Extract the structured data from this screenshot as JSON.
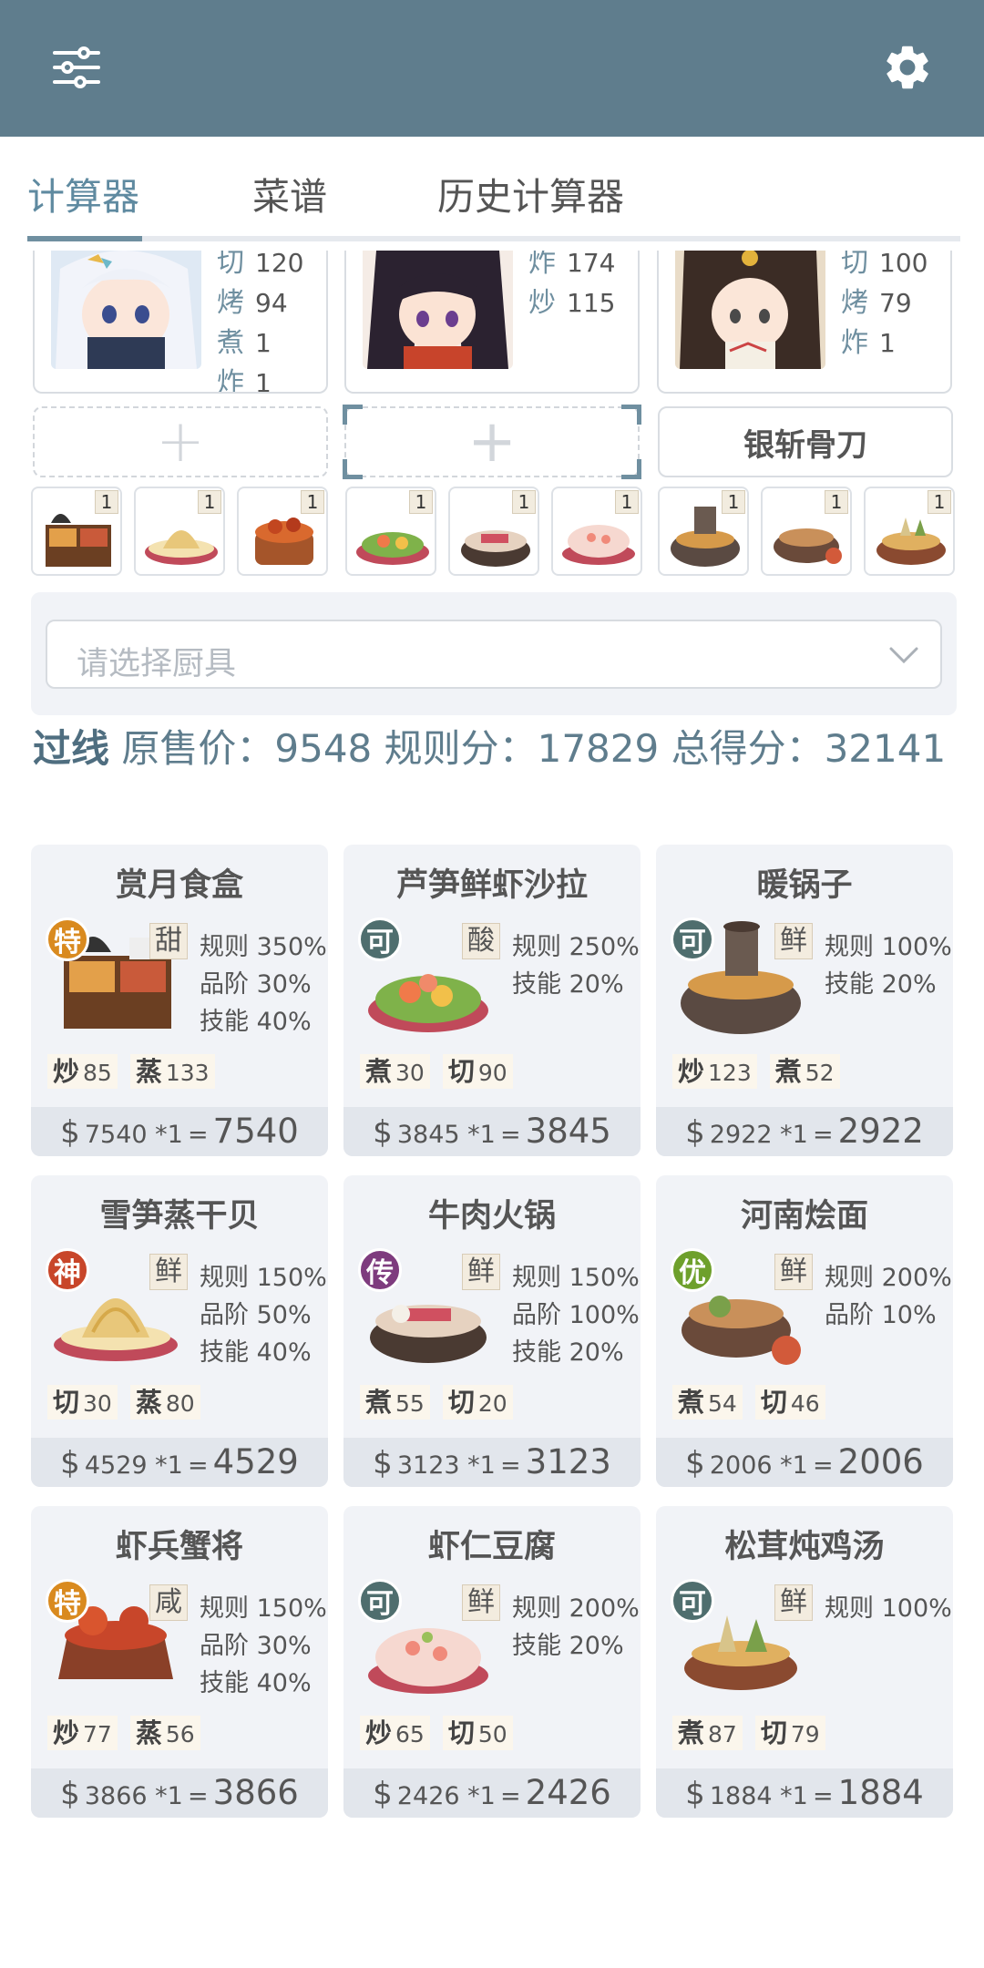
{
  "tabs": [
    {
      "label": "计算器",
      "active": true
    },
    {
      "label": "菜谱",
      "active": false
    },
    {
      "label": "历史计算器",
      "active": false
    }
  ],
  "chefs": [
    {
      "skills": [
        {
          "k": "切",
          "v": "120"
        },
        {
          "k": "烤",
          "v": "94"
        },
        {
          "k": "煮",
          "v": "1"
        },
        {
          "k": "炸",
          "v": "1"
        }
      ]
    },
    {
      "skills": [
        {
          "k": "炸",
          "v": "174"
        },
        {
          "k": "炒",
          "v": "115"
        }
      ]
    },
    {
      "skills": [
        {
          "k": "切",
          "v": "100"
        },
        {
          "k": "烤",
          "v": "79"
        },
        {
          "k": "炸",
          "v": "1"
        }
      ]
    }
  ],
  "slots": {
    "tool_name": "银斩骨刀"
  },
  "thumb_qty": [
    "1",
    "1",
    "1",
    "1",
    "1",
    "1",
    "1",
    "1",
    "1"
  ],
  "utensil": {
    "placeholder": "请选择厨具"
  },
  "score": {
    "pass": "过线",
    "text": "原售价：9548 规则分：17829 总得分：32141"
  },
  "recipes": [
    {
      "name": "赏月食盒",
      "rarity": "特",
      "rarity_color": "#d98a1f",
      "taste": "甜",
      "buffs": [
        "规则 350%",
        "品阶 30%",
        "技能 40%"
      ],
      "skills": [
        {
          "k": "炒",
          "v": "85"
        },
        {
          "k": "蒸",
          "v": "133"
        }
      ],
      "unit": "7540 *1",
      "total": "7540"
    },
    {
      "name": "芦笋鲜虾沙拉",
      "rarity": "可",
      "rarity_color": "#4f6e6e",
      "taste": "酸",
      "buffs": [
        "规则 250%",
        "技能 20%"
      ],
      "skills": [
        {
          "k": "煮",
          "v": "30"
        },
        {
          "k": "切",
          "v": "90"
        }
      ],
      "unit": "3845 *1",
      "total": "3845"
    },
    {
      "name": "暖锅子",
      "rarity": "可",
      "rarity_color": "#4f6e6e",
      "taste": "鲜",
      "buffs": [
        "规则 100%",
        "技能 20%"
      ],
      "skills": [
        {
          "k": "炒",
          "v": "123"
        },
        {
          "k": "煮",
          "v": "52"
        }
      ],
      "unit": "2922 *1",
      "total": "2922"
    },
    {
      "name": "雪笋蒸干贝",
      "rarity": "神",
      "rarity_color": "#c8462a",
      "taste": "鲜",
      "buffs": [
        "规则 150%",
        "品阶 50%",
        "技能 40%"
      ],
      "skills": [
        {
          "k": "切",
          "v": "30"
        },
        {
          "k": "蒸",
          "v": "80"
        }
      ],
      "unit": "4529 *1",
      "total": "4529"
    },
    {
      "name": "牛肉火锅",
      "rarity": "传",
      "rarity_color": "#7e3b7e",
      "taste": "鲜",
      "buffs": [
        "规则 150%",
        "品阶 100%",
        "技能 20%"
      ],
      "skills": [
        {
          "k": "煮",
          "v": "55"
        },
        {
          "k": "切",
          "v": "20"
        }
      ],
      "unit": "3123 *1",
      "total": "3123"
    },
    {
      "name": "河南烩面",
      "rarity": "优",
      "rarity_color": "#6ea02c",
      "taste": "鲜",
      "buffs": [
        "规则 200%",
        "品阶 10%"
      ],
      "skills": [
        {
          "k": "煮",
          "v": "54"
        },
        {
          "k": "切",
          "v": "46"
        }
      ],
      "unit": "2006 *1",
      "total": "2006"
    },
    {
      "name": "虾兵蟹将",
      "rarity": "特",
      "rarity_color": "#d98a1f",
      "taste": "咸",
      "buffs": [
        "规则 150%",
        "品阶 30%",
        "技能 40%"
      ],
      "skills": [
        {
          "k": "炒",
          "v": "77"
        },
        {
          "k": "蒸",
          "v": "56"
        }
      ],
      "unit": "3866 *1",
      "total": "3866"
    },
    {
      "name": "虾仁豆腐",
      "rarity": "可",
      "rarity_color": "#4f6e6e",
      "taste": "鲜",
      "buffs": [
        "规则 200%",
        "技能 20%"
      ],
      "skills": [
        {
          "k": "炒",
          "v": "65"
        },
        {
          "k": "切",
          "v": "50"
        }
      ],
      "unit": "2426 *1",
      "total": "2426"
    },
    {
      "name": "松茸炖鸡汤",
      "rarity": "可",
      "rarity_color": "#4f6e6e",
      "taste": "鲜",
      "buffs": [
        "规则 100%"
      ],
      "skills": [
        {
          "k": "煮",
          "v": "87"
        },
        {
          "k": "切",
          "v": "79"
        }
      ],
      "unit": "1884 *1",
      "total": "1884"
    }
  ],
  "currency": "$",
  "eq": "="
}
